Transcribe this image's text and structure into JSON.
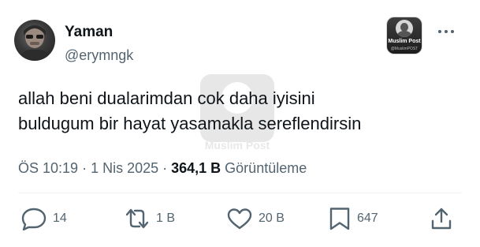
{
  "author": {
    "display_name": "Yaman",
    "handle": "@erymngk"
  },
  "badge": {
    "title": "Muslim Post",
    "subtitle": "@MuslimPOST"
  },
  "watermark": {
    "label": "Muslim Post"
  },
  "tweet": {
    "lines": [
      "allah beni dualarimdan cok daha iyisini",
      "buldugum bir hayat yasamakla sereflendirsin"
    ]
  },
  "meta": {
    "time": "ÖS 10:19",
    "separator1": " · ",
    "date": "1 Nis 2025",
    "separator2": " · ",
    "views_count": "364,1 B",
    "views_label": " Görüntüleme"
  },
  "actions": {
    "replies": "14",
    "reposts": "1 B",
    "likes": "20 B",
    "bookmarks": "647"
  },
  "icons": {
    "more": "more-icon",
    "reply": "reply-icon",
    "repost": "repost-icon",
    "like": "heart-icon",
    "bookmark": "bookmark-icon",
    "share": "share-icon"
  },
  "colors": {
    "text": "#0f1419",
    "secondary": "#536471",
    "divider": "#eff3f4",
    "background": "#ffffff"
  }
}
